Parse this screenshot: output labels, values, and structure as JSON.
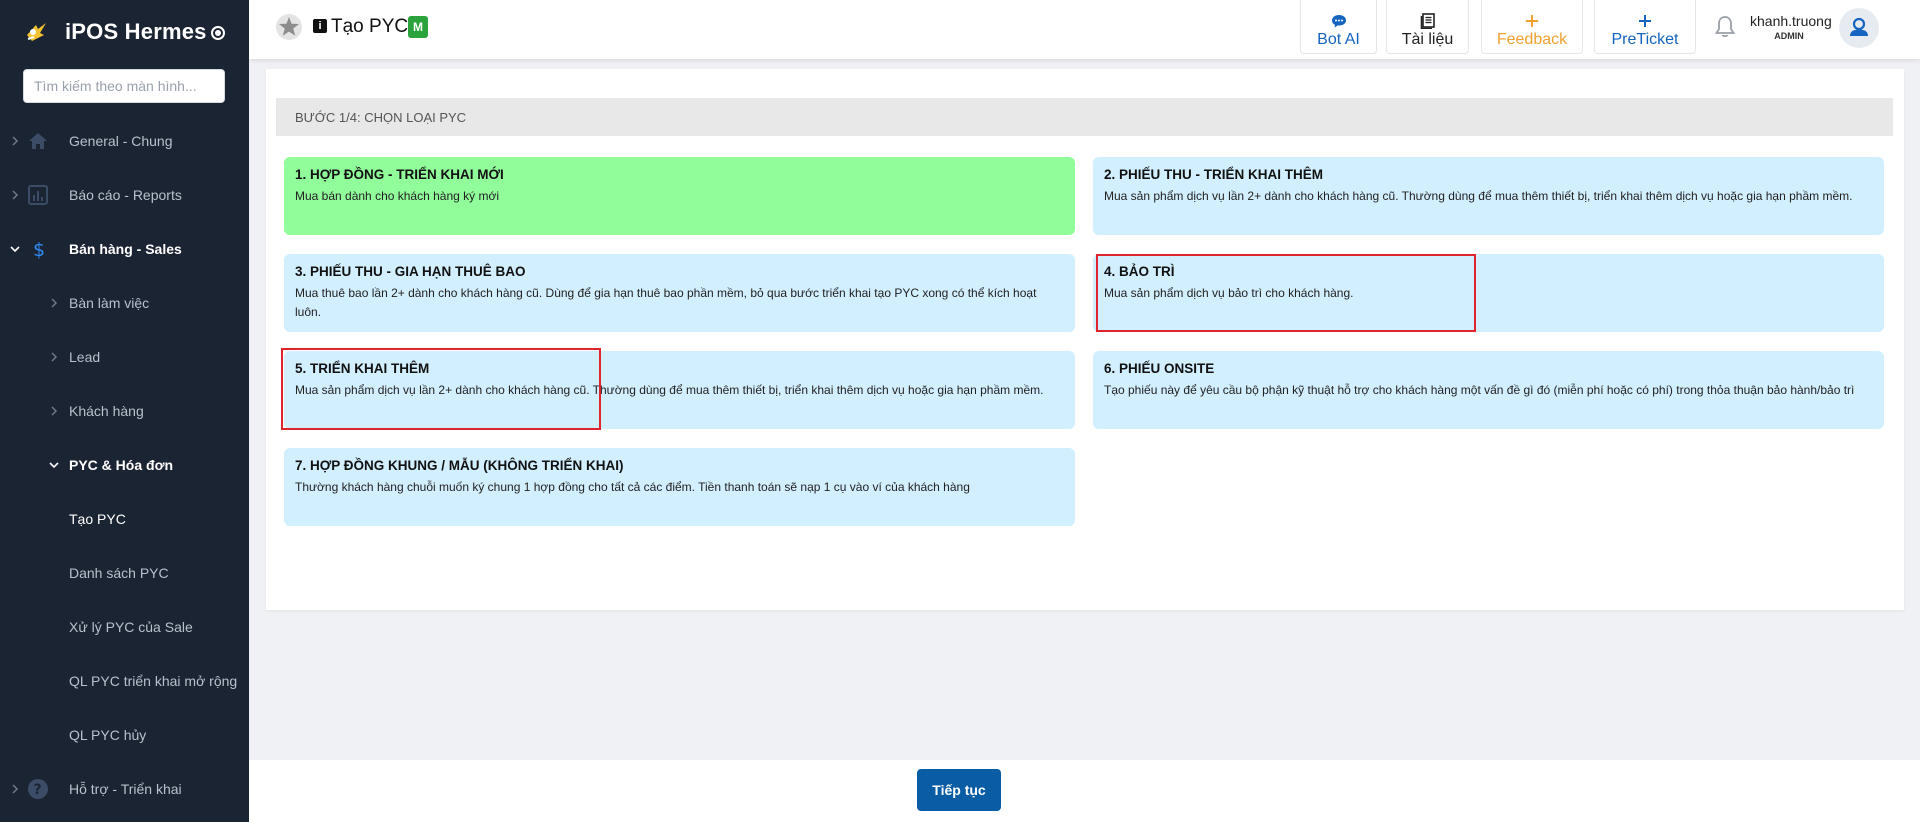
{
  "sidebar": {
    "app_title": "iPOS Hermes",
    "search_placeholder": "Tìm kiếm theo màn hình...",
    "items": [
      {
        "label": "General - Chung",
        "icon": "home-icon"
      },
      {
        "label": "Báo cáo - Reports",
        "icon": "bar-chart-icon"
      },
      {
        "label": "Bán hàng - Sales",
        "icon": "dollar-icon",
        "expanded": true
      },
      {
        "label": "Hỗ trợ - Triển khai",
        "icon": "help-circle-icon"
      }
    ],
    "sales_sub": [
      {
        "label": "Bàn làm việc"
      },
      {
        "label": "Lead"
      },
      {
        "label": "Khách hàng"
      },
      {
        "label": "PYC & Hóa đơn",
        "expanded": true
      }
    ],
    "pyc_sub": [
      {
        "label": "Tạo PYC",
        "current": true
      },
      {
        "label": "Danh sách PYC"
      },
      {
        "label": "Xử lý PYC của Sale"
      },
      {
        "label": "QL PYC triển khai mở rộng"
      },
      {
        "label": "QL PYC hủy"
      }
    ]
  },
  "header": {
    "page_title": "Tạo PYC",
    "badge": "M",
    "buttons": [
      {
        "label": "Bot AI",
        "icon": "chat-icon",
        "color": "#1565c0"
      },
      {
        "label": "Tài liệu",
        "icon": "book-icon",
        "color": "#222222"
      },
      {
        "label": "Feedback",
        "icon": "plus-icon",
        "color": "#f0a030"
      },
      {
        "label": "PreTicket",
        "icon": "plus-icon",
        "color": "#1565c0"
      }
    ],
    "user": {
      "name": "khanh.truong",
      "role": "ADMIN"
    }
  },
  "main": {
    "step_label": "BƯỚC 1/4: CHỌN LOẠI PYC",
    "cards": [
      {
        "title": "1. HỢP ĐỒNG - TRIỂN KHAI MỚI",
        "desc": "Mua bán dành cho khách hàng ký mới",
        "selected": true
      },
      {
        "title": "2. PHIẾU THU - TRIỂN KHAI THÊM",
        "desc": "Mua sản phẩm dịch vụ lần 2+ dành cho khách hàng cũ. Thường dùng để mua thêm thiết bị, triển khai thêm dịch vụ hoặc gia hạn phầm mềm."
      },
      {
        "title": "3. PHIẾU THU - GIA HẠN THUÊ BAO",
        "desc": "Mua thuê bao lần 2+ dành cho khách hàng cũ. Dùng để gia hạn thuê bao phần mềm, bỏ qua bước triển khai tạo PYC xong có thể kích hoạt luôn."
      },
      {
        "title": "4. BẢO TRÌ",
        "desc": "Mua sản phẩm dịch vụ bảo trì cho khách hàng."
      },
      {
        "title": "5. TRIỂN KHAI THÊM",
        "desc": "Mua sản phẩm dịch vụ lần 2+ dành cho khách hàng cũ. Thường dùng để mua thêm thiết bị, triển khai thêm dịch vụ hoặc gia hạn phầm mềm."
      },
      {
        "title": "6. PHIẾU ONSITE",
        "desc": "Tạo phiếu này để yêu cầu bộ phận kỹ thuật hỗ trợ cho khách hàng một vấn đề gì đó (miễn phí hoặc có phí) trong thỏa thuận bảo hành/bảo trì"
      },
      {
        "title": "7. HỢP ĐỒNG KHUNG / MẪU (KHÔNG TRIỂN KHAI)",
        "desc": "Thường khách hàng chuỗi muốn ký chung 1 hợp đồng cho tất cả các điểm. Tiền thanh toán sẽ nạp 1 cụ vào ví của khách hàng"
      }
    ]
  },
  "footer": {
    "continue_label": "Tiếp tục"
  },
  "colors": {
    "sidebar_bg": "#1b2433",
    "card_bg": "#d1efff",
    "card_selected_bg": "#90fc9a",
    "primary_button": "#0a5da5",
    "highlight_border": "#e0242d"
  }
}
